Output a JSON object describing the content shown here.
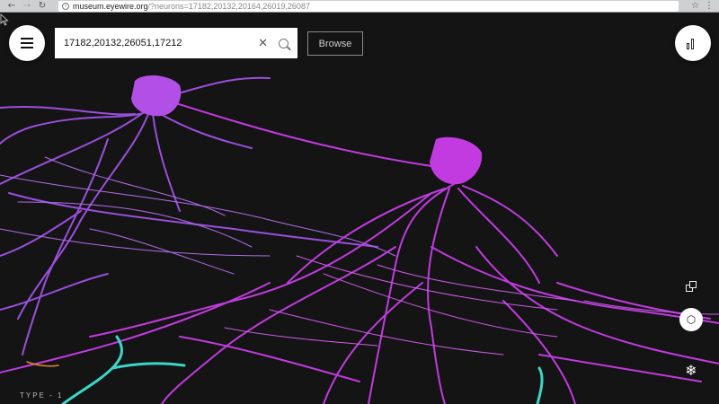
{
  "browser": {
    "url_host": "museum.eyewire.org",
    "url_rest": "/?neurons=17182,20132,20164,26019,26087"
  },
  "search": {
    "value": "17182,20132,26051,17212"
  },
  "browse_label": "Browse",
  "type_label": "TYPE - 1",
  "colors": {
    "neuron_magenta": "#c13be0",
    "neuron_violet": "#9a4fdc",
    "neuron_cyan": "#3dd6c6",
    "neuron_orange": "#e08a2a",
    "background": "#141414"
  },
  "icons": [
    "menu-icon",
    "clear-icon",
    "search-icon",
    "bar-chart-icon",
    "copy-icon",
    "cube-icon",
    "snowflake-icon",
    "cursor-icon"
  ]
}
